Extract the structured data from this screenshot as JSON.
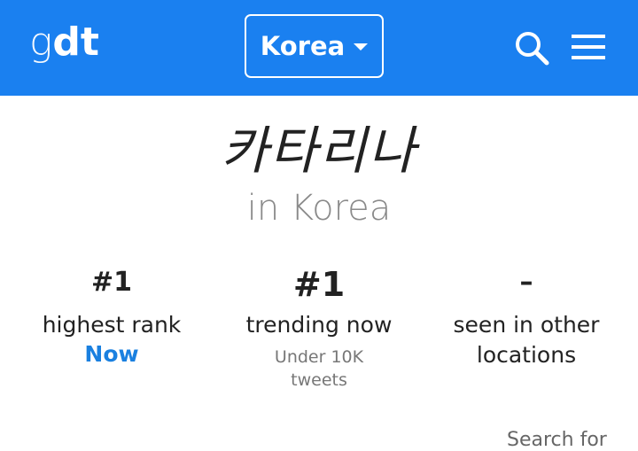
{
  "colors": {
    "header_bg": "#1a80f0",
    "accent": "#1a80e0",
    "text_primary": "#222222",
    "text_muted": "#8a8a8a"
  },
  "header": {
    "logo_g": "g",
    "logo_dt": "dt",
    "country_selector": {
      "label": "Korea",
      "icon": "chevron-down-icon"
    },
    "search_icon": "search-icon",
    "menu_icon": "hamburger-menu-icon"
  },
  "main": {
    "title": "카타리나",
    "subtitle": "in Korea",
    "stats": [
      {
        "value": "#1",
        "label": "highest rank",
        "extra": "Now"
      },
      {
        "value": "#1",
        "label": "trending now",
        "extra_line1": "Under 10K",
        "extra_line2": "tweets"
      },
      {
        "value": "–",
        "label_line1": "seen in other",
        "label_line2": "locations"
      }
    ],
    "search_for": "Search for"
  }
}
